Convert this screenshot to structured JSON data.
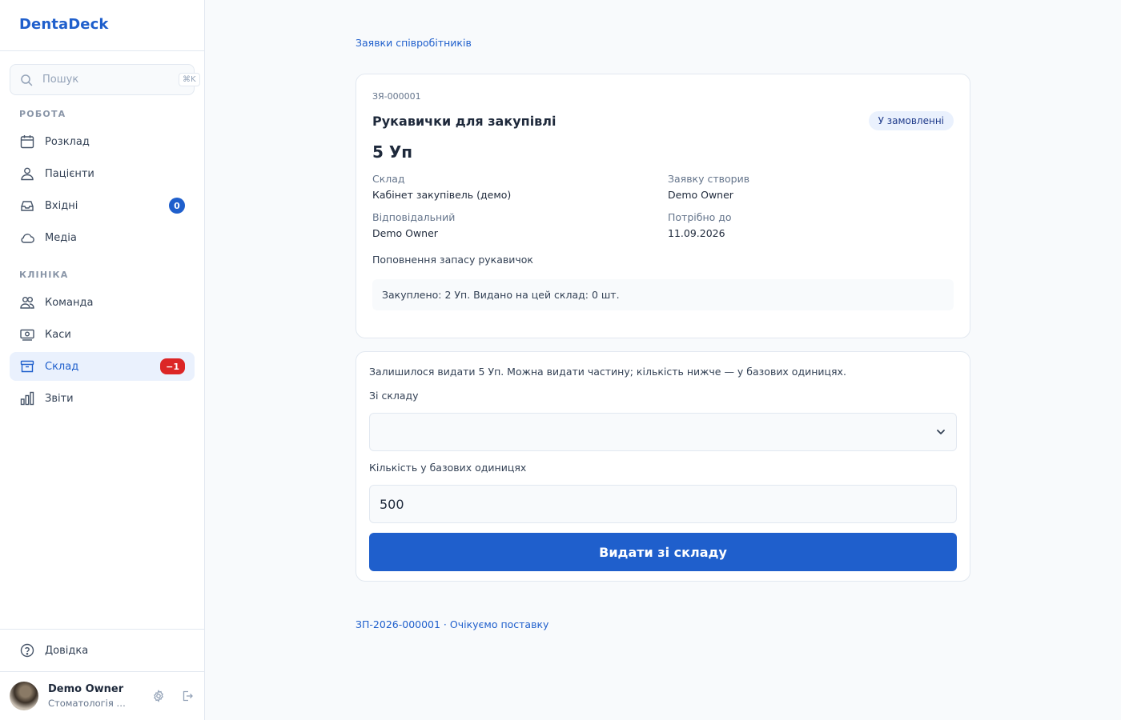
{
  "brand": {
    "name": "DentaDeck"
  },
  "search": {
    "placeholder": "Пошук",
    "shortcut": "⌘K"
  },
  "sidebar": {
    "sections": [
      {
        "label": "РОБОТА"
      },
      {
        "label": "КЛІНІКА"
      }
    ],
    "items": [
      {
        "label": "Розклад",
        "icon": "calendar-icon"
      },
      {
        "label": "Пацієнти",
        "icon": "patients-icon"
      },
      {
        "label": "Вхідні",
        "icon": "inbox-icon",
        "badge": "0"
      },
      {
        "label": "Медіа",
        "icon": "cloud-icon"
      },
      {
        "label": "Команда",
        "icon": "team-icon"
      },
      {
        "label": "Каси",
        "icon": "cash-register-icon"
      },
      {
        "label": "Склад",
        "icon": "warehouse-icon",
        "badge": "−1",
        "active": true
      },
      {
        "label": "Звіти",
        "icon": "reports-icon"
      }
    ],
    "help": {
      "label": "Довідка",
      "icon": "help-icon"
    },
    "user": {
      "name": "Demo Owner",
      "org": "Стоматологія П..."
    }
  },
  "breadcrumb": {
    "label": "Заявки співробітників"
  },
  "request": {
    "number": "ЗЯ-000001",
    "title": "Рукавички для закупівлі",
    "status": "У замовленні",
    "quantity": "5 Уп",
    "fields": [
      {
        "label": "Склад",
        "value": "Кабінет закупівель (демо)"
      },
      {
        "label": "Заявку створив",
        "value": "Demo Owner"
      },
      {
        "label": "Відповідальний",
        "value": "Demo Owner"
      },
      {
        "label": "Потрібно до",
        "value": "11.09.2026"
      }
    ],
    "note": "Поповнення запасу рукавичок",
    "summary": "Закуплено: 2 Уп. Видано на цей склад: 0 шт."
  },
  "issue_form": {
    "info": "Залишилося видати 5 Уп. Можна видати частину; кількість нижче — у базових одиницях.",
    "from_label": "Зі складу",
    "from_value": "",
    "qty_label": "Кількість у базових одиницях",
    "qty_value": "500",
    "submit_label": "Видати зі складу"
  },
  "order_link": {
    "label": "ЗП-2026-000001 · Очікуємо поставку"
  },
  "colors": {
    "accent": "#1f5fcc",
    "danger": "#dc2626",
    "active_bg": "#eaf1fd"
  }
}
